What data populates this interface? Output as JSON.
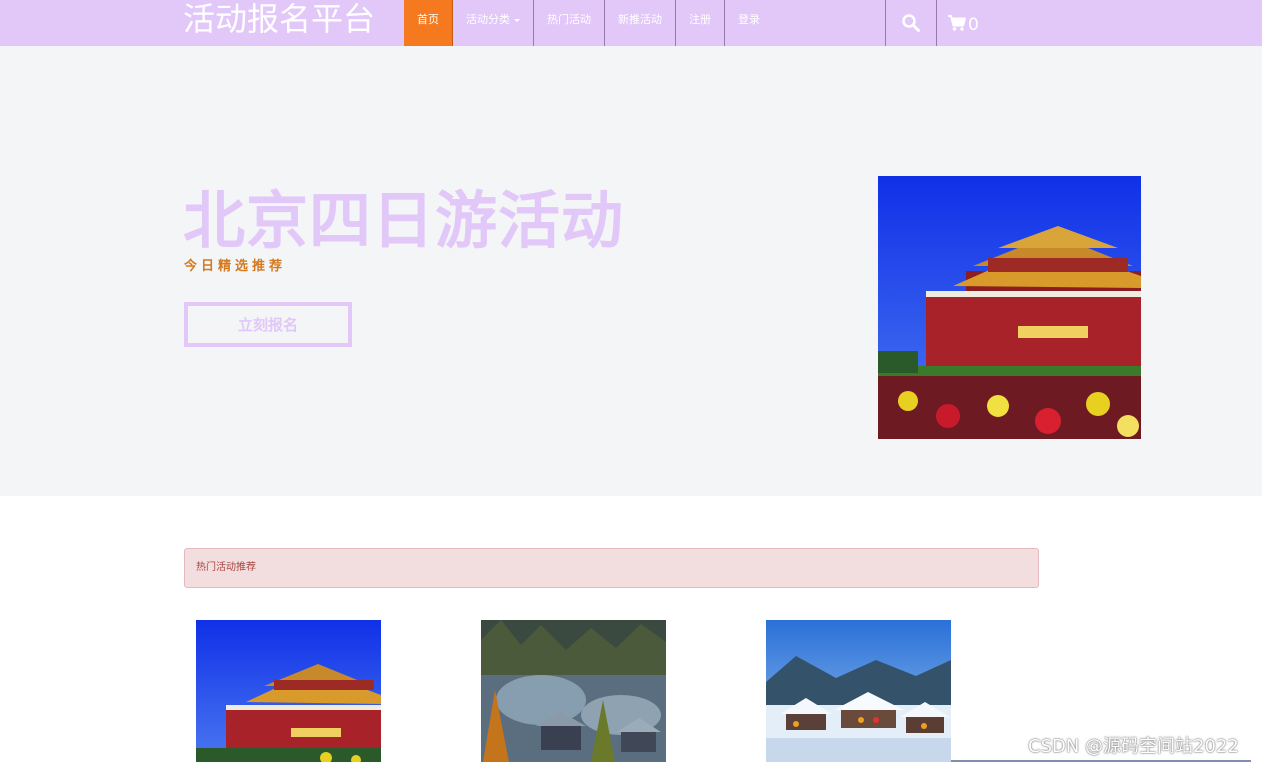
{
  "navbar": {
    "brand": "活动报名平台",
    "items": [
      {
        "label": "首页",
        "active": true
      },
      {
        "label": "活动分类",
        "dropdown": true
      },
      {
        "label": "热门活动"
      },
      {
        "label": "新推活动"
      },
      {
        "label": "注册"
      },
      {
        "label": "登录"
      }
    ],
    "search_icon": "search-icon",
    "cart_icon": "shopping-cart-icon",
    "cart_count": "0"
  },
  "hero": {
    "title": "北京四日游活动",
    "subtitle": "今日精选推荐",
    "button_label": "立刻报名",
    "image": "tiananmen-gate-photo"
  },
  "hot_section": {
    "header": "热门活动推荐",
    "cards": [
      {
        "image": "tiananmen-gate-photo"
      },
      {
        "image": "autumn-village-photo"
      },
      {
        "image": "snow-village-photo"
      }
    ]
  },
  "watermark": "CSDN @源码空间站2022",
  "colors": {
    "navbar_bg": "#e2c8f8",
    "active_nav": "#f5791f",
    "hero_bg": "#f3f5f7",
    "hero_title": "#e2c8f8",
    "subtitle": "#d4791f",
    "alert_bg": "#f2dede",
    "alert_text": "#a94442"
  }
}
